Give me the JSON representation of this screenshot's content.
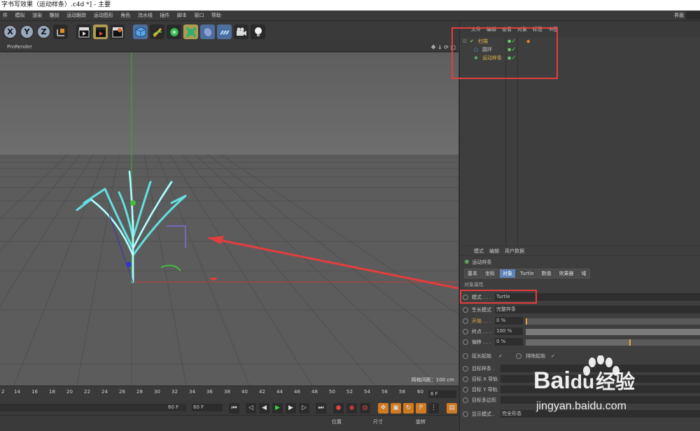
{
  "title": "字书写效果（运动样条）.c4d *] - 主要",
  "menu": [
    "件",
    "模拟",
    "渲染",
    "雕刻",
    "运动跟踪",
    "运动图形",
    "角色",
    "流水线",
    "插件",
    "脚本",
    "窗口",
    "帮助"
  ],
  "menu_right": "界面",
  "toolbar": {
    "axis_x": "X",
    "axis_y": "Y",
    "axis_z": "Z",
    "icons": [
      "coordinate-system-icon",
      "render-view-icon",
      "render-picture-queue-icon",
      "render-settings-icon",
      "cube-icon",
      "pen-icon",
      "subdivision-icon",
      "array-icon",
      "deformer-icon",
      "floor-icon",
      "camera-icon",
      "light-icon"
    ]
  },
  "viewport": {
    "renderer_label": "ProRender",
    "nav_icons": "✥ ↓ ⟳ ▢",
    "grid_scale": "网格间距：100 cm"
  },
  "object_manager": {
    "menu": [
      "文件",
      "编辑",
      "查看",
      "对象",
      "标签",
      "书签"
    ],
    "objects": [
      {
        "name": "扫描",
        "level": 0
      },
      {
        "name": "圆环",
        "level": 1
      },
      {
        "name": "运动样条",
        "level": 1
      }
    ]
  },
  "attribute_manager": {
    "menu": [
      "模式",
      "编辑",
      "用户数据"
    ],
    "object_name": "运动样条",
    "tabs": [
      "基本",
      "坐标",
      "对象",
      "Turtle",
      "数值",
      "效果器",
      "域"
    ],
    "active_tab": "对象",
    "section": "对象属性",
    "properties": [
      {
        "label": "模式 . . .",
        "value": "Turtle"
      },
      {
        "label": "生长模式",
        "value": "完整样条"
      },
      {
        "label": "开始 . . .",
        "value": "0 %",
        "fill": 0.0
      },
      {
        "label": "终点 . . .",
        "value": "100 %",
        "fill": 1.0
      },
      {
        "label": "偏移 . . .",
        "value": "0 %",
        "fill": 0.6
      }
    ],
    "checks": [
      {
        "label": "延长起始",
        "value": "✓"
      },
      {
        "label": "排除起始",
        "value": "✓"
      }
    ],
    "targets": [
      "目标样条 .",
      "目标 X 导轨",
      "目标 Y 导轨",
      "目标多边形"
    ],
    "display_mode_label": "显示模式 .",
    "display_mode_value": "完全形态"
  },
  "timeline": {
    "ticks": [
      "2",
      "14",
      "16",
      "18",
      "20",
      "22",
      "24",
      "26",
      "28",
      "30",
      "32",
      "34",
      "36",
      "38",
      "40",
      "42",
      "44",
      "46",
      "48",
      "50",
      "52",
      "54",
      "56",
      "58",
      "60"
    ],
    "frame_field": "6 F",
    "end_frame_a": "60 F",
    "end_frame_b": "60 F"
  },
  "coordinates": {
    "labels": [
      "位置",
      "尺寸",
      "旋转"
    ]
  },
  "watermark": {
    "brand": "Bai",
    "brand2": "du",
    "brand_cn": "经验",
    "url": "jingyan.baidu.com"
  },
  "colors": {
    "accent": "#5d82b8",
    "highlight": "#e43d3d",
    "selected_text": "#e2b44a",
    "spline": "#63e0e0"
  }
}
